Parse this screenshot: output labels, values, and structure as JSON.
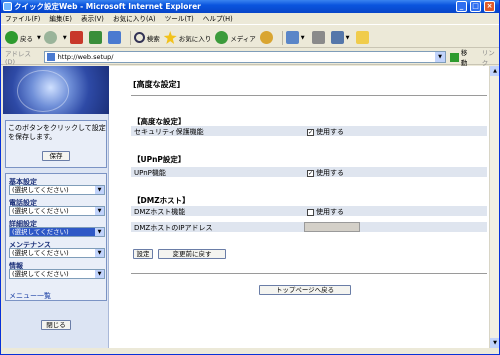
{
  "window": {
    "title": "クイック設定Web - Microsoft Internet Explorer",
    "minimize": "_",
    "maximize": "□",
    "close": "×"
  },
  "menu": {
    "items": [
      "ファイル(F)",
      "編集(E)",
      "表示(V)",
      "お気に入り(A)",
      "ツール(T)",
      "ヘルプ(H)"
    ]
  },
  "toolbar": {
    "back": "戻る",
    "search": "検索",
    "favorites": "お気に入り",
    "media": "メディア"
  },
  "address": {
    "label": "アドレス(D)",
    "url": "http://web.setup/",
    "go": "移動",
    "links": "リンク"
  },
  "left": {
    "save_message": "このボタンをクリックして設定を保存します。",
    "save_button": "保存",
    "sections": [
      {
        "heading": "基本設定",
        "select": "(選択してください)"
      },
      {
        "heading": "電話設定",
        "select": "(選択してください)"
      },
      {
        "heading": "詳細設定",
        "select": "(選択してください)"
      },
      {
        "heading": "メンテナンス",
        "select": "(選択してください)"
      },
      {
        "heading": "情報",
        "select": "(選択してください)"
      }
    ],
    "menu_list": "メニュー一覧",
    "close_button": "閉じる"
  },
  "main": {
    "page_title": "[高度な設定]",
    "advanced": {
      "heading": "【高度な設定】",
      "label": "セキュリティ保護機能",
      "value": "使用する",
      "checked": true
    },
    "upnp": {
      "heading": "【UPnP設定】",
      "label": "UPnP機能",
      "value": "使用する",
      "checked": true
    },
    "dmz": {
      "heading": "【DMZホスト】",
      "label": "DMZホスト機能",
      "value": "使用する",
      "checked": false,
      "ip_label": "DMZホストのIPアドレス"
    },
    "set_button": "設定",
    "revert_button": "変更前に戻す",
    "top_button": "トップページへ戻る"
  },
  "colors": {
    "titlebar": "#0a54de",
    "left_pane": "#dce4f3",
    "row": "#dfe5ef",
    "selected": "#2e58c6"
  }
}
